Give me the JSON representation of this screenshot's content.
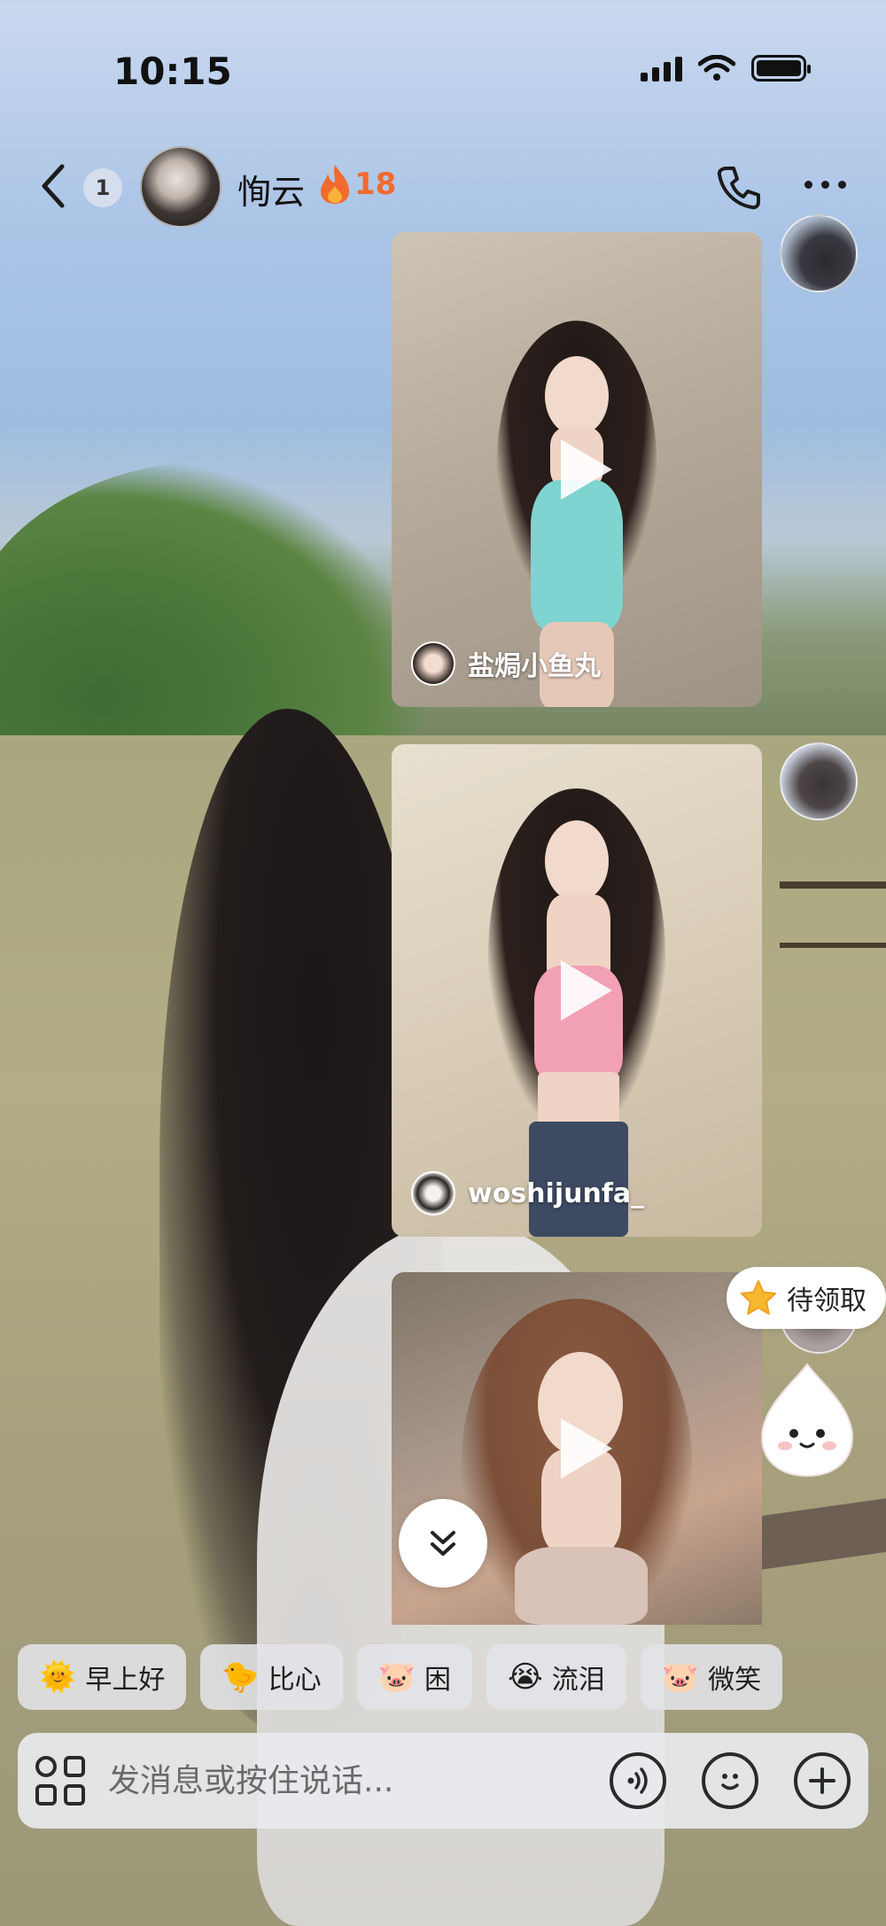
{
  "status_bar": {
    "time": "10:15"
  },
  "header": {
    "unread_count": "1",
    "contact_name": "恂云",
    "streak_count": "18",
    "icons": [
      "back-icon",
      "fire-icon",
      "phone-icon",
      "more-icon"
    ]
  },
  "messages": [
    {
      "type": "video",
      "author": "盐焗小鱼丸",
      "top_color": "#7fd3d0"
    },
    {
      "type": "video",
      "author": "woshijunfa_",
      "top_color": "#f2a0b4"
    },
    {
      "type": "video",
      "author": "",
      "top_color": "#d9c3b8"
    }
  ],
  "reward": {
    "label": "待领取"
  },
  "quick_replies": [
    {
      "emoji": "🌞",
      "label": "早上好"
    },
    {
      "emoji": "🐤",
      "label": "比心"
    },
    {
      "emoji": "🐷",
      "label": "困"
    },
    {
      "emoji": "😭",
      "label": "流泪"
    },
    {
      "emoji": "🐷",
      "label": "微笑"
    }
  ],
  "composer": {
    "placeholder": "发消息或按住说话...",
    "icons": [
      "apps-icon",
      "voice-icon",
      "emoji-icon",
      "plus-icon"
    ]
  },
  "colors": {
    "streak": "#f26a2e",
    "accent_star": "#f5b82e"
  }
}
